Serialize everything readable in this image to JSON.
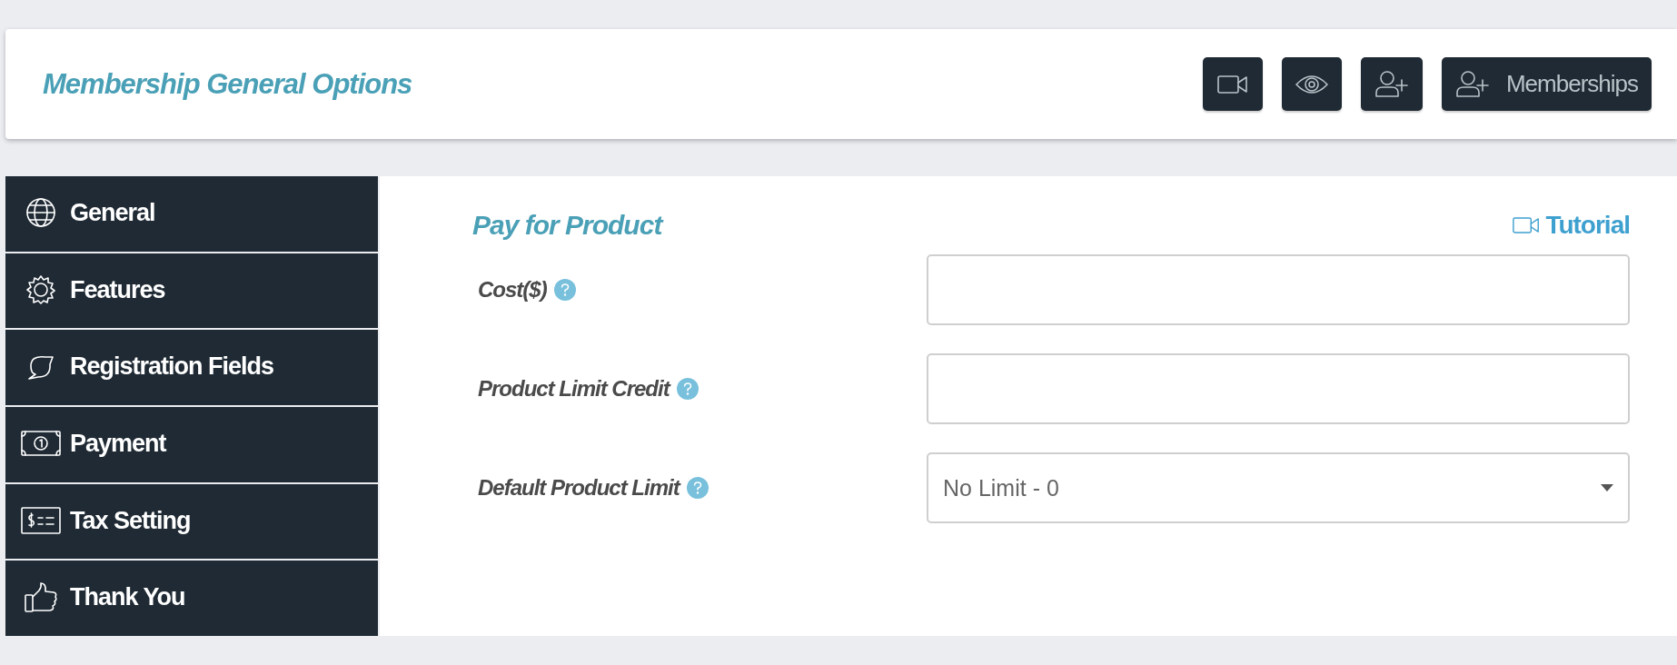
{
  "header": {
    "title": "Membership General Options",
    "buttons": [
      {
        "kind": "video"
      },
      {
        "kind": "eye"
      },
      {
        "kind": "user-plus"
      },
      {
        "kind": "user-plus",
        "label": "Memberships"
      }
    ]
  },
  "sidebar": {
    "items": [
      {
        "label": "General"
      },
      {
        "label": "Features"
      },
      {
        "label": "Registration Fields"
      },
      {
        "label": "Payment"
      },
      {
        "label": "Tax Setting"
      },
      {
        "label": "Thank You"
      }
    ]
  },
  "panel": {
    "title": "Pay for Product",
    "tutorial": "Tutorial",
    "fields": [
      {
        "kind": "text",
        "label": "Cost($)"
      },
      {
        "kind": "text",
        "label": "Product Limit Credit"
      },
      {
        "kind": "select",
        "label": "Default Product Limit",
        "value": "No Limit - 0"
      }
    ]
  }
}
